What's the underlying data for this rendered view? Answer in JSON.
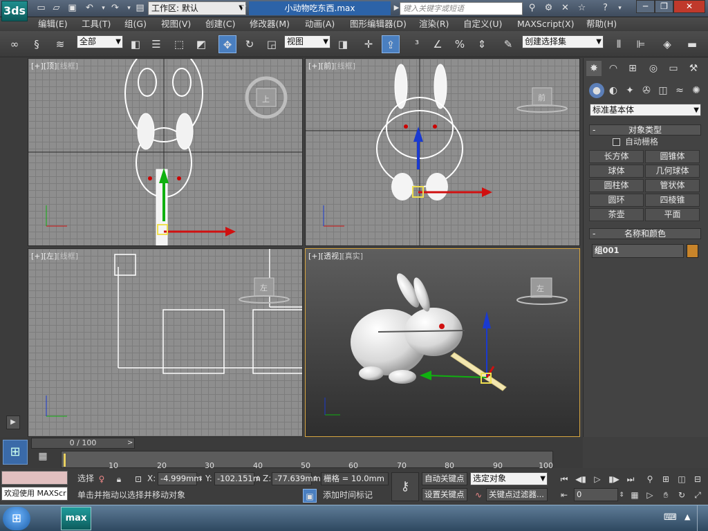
{
  "app": {
    "logo_label": "3ds",
    "workspace": "工作区: 默认",
    "document_title": "小动物吃东西.max",
    "search_placeholder": "键入关键字或短语"
  },
  "menubar": {
    "items": [
      "编辑(E)",
      "工具(T)",
      "组(G)",
      "视图(V)",
      "创建(C)",
      "修改器(M)",
      "动画(A)",
      "图形编辑器(D)",
      "渲染(R)",
      "自定义(U)",
      "MAXScript(X)",
      "帮助(H)"
    ]
  },
  "toolbar": {
    "filter_value": "全部",
    "refcoord_value": "视图",
    "selection_set_placeholder": "创建选择集"
  },
  "viewports": {
    "top": {
      "plus": "[+]",
      "name": "[顶]",
      "mode": "[线框]",
      "cube_label": "上"
    },
    "front": {
      "plus": "[+]",
      "name": "[前]",
      "mode": "[线框]",
      "cube_label": "前"
    },
    "left": {
      "plus": "[+]",
      "name": "[左]",
      "mode": "[线框]",
      "cube_label": "左"
    },
    "persp": {
      "plus": "[+]",
      "name": "[透视]",
      "mode": "[真实]",
      "cube_label": "左"
    }
  },
  "command_panel": {
    "category": "标准基本体",
    "object_type_title": "对象类型",
    "autogrid_label": "自动栅格",
    "objects": [
      "长方体",
      "圆锥体",
      "球体",
      "几何球体",
      "圆柱体",
      "管状体",
      "圆环",
      "四棱锥",
      "茶壶",
      "平面"
    ],
    "name_color_title": "名称和颜色",
    "object_name": "组001",
    "object_color": "#c8842a"
  },
  "timeline": {
    "slider_label": "0 / 100",
    "ticks": [
      "10",
      "20",
      "30",
      "40",
      "50",
      "60",
      "70",
      "80",
      "90",
      "100"
    ]
  },
  "status": {
    "maxscript_label": "欢迎使用 MAXScr",
    "select_label": "选择",
    "x_label": "X:",
    "x_value": "-4.999mm",
    "y_label": "Y:",
    "y_value": "-102.151m",
    "z_label": "Z:",
    "z_value": "-77.639mm",
    "grid_label": "栅格 = 10.0mm",
    "prompt": "单击并拖动以选择并移动对象",
    "add_time_tag": "添加时间标记",
    "auto_key": "自动关键点",
    "set_key": "设置关键点",
    "key_mode": "选定对象",
    "key_filters": "关键点过滤器...",
    "frame_value": "0"
  }
}
